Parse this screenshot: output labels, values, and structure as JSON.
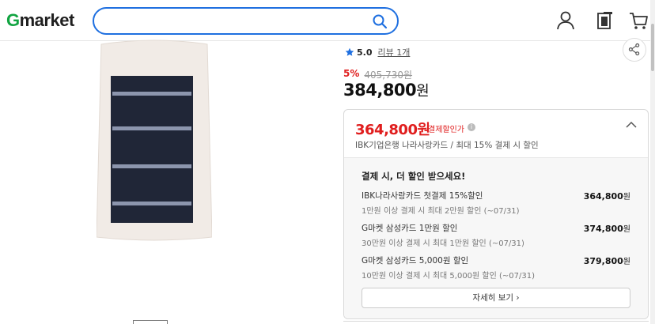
{
  "header": {
    "logo_g": "G",
    "logo_rest": "market",
    "search_value": "",
    "search_placeholder": ""
  },
  "icons": {
    "search": "search-icon",
    "user": "user-icon",
    "recent": "recent-view-icon",
    "cart": "cart-icon",
    "share": "share-icon",
    "star": "star-icon",
    "info": "info-icon",
    "chevron": "chevron-up-icon"
  },
  "product": {
    "rating": "5.0",
    "review_text": "리뷰 1개",
    "discount_rate": "5%",
    "original_price": "405,730원",
    "price_number": "384,800",
    "price_unit": "원"
  },
  "card_benefit": {
    "best_price_text": "364,800원",
    "best_label": "결제할인가",
    "best_desc": "IBK기업은행 나라사랑카드 / 최대 15% 결제 시 할인",
    "list_title": "결제 시, 더 할인 받으세요!",
    "rows": [
      {
        "name": "IBK나라사랑카드 첫결제 15%할인",
        "condition": "1만원 이상 결제 시 최대 2만원 할인 (~07/31)",
        "amount": "364,800",
        "unit": "원"
      },
      {
        "name": "G마켓 삼성카드 1만원 할인",
        "condition": "30만원 이상 결제 시 최대 1만원 할인 (~07/31)",
        "amount": "374,800",
        "unit": "원"
      },
      {
        "name": "G마켓 삼성카드 5,000원 할인",
        "condition": "10만원 이상 결제 시 최대 5,000원 할인 (~07/31)",
        "amount": "379,800",
        "unit": "원"
      }
    ],
    "detail_button": "자세히 보기 ›"
  },
  "colors": {
    "brand_green": "#11a441",
    "search_border": "#1e6fe0",
    "discount_red": "#e01e1e",
    "star_blue": "#1e6fe0"
  }
}
